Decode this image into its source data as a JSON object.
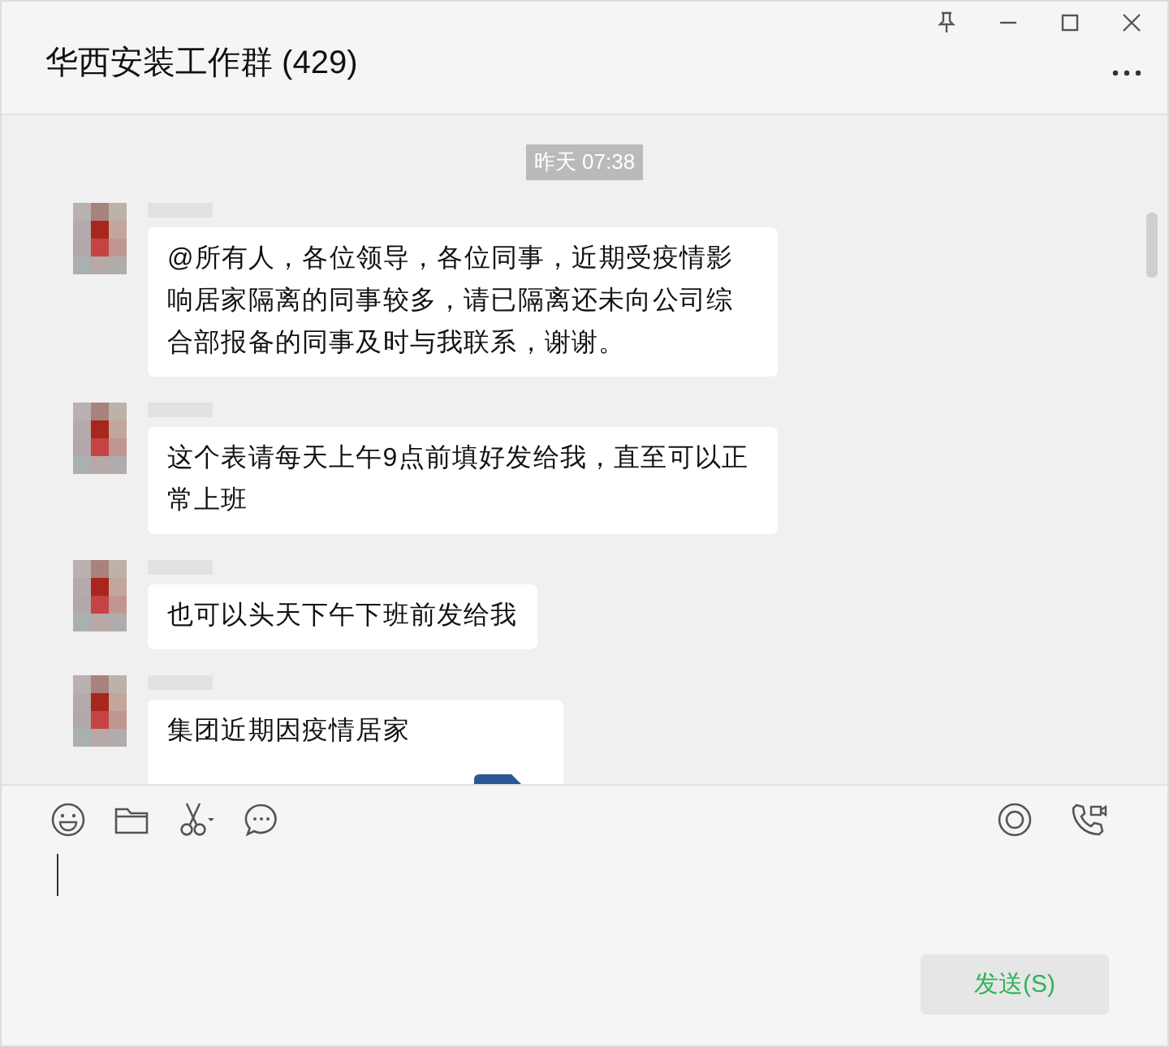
{
  "window": {
    "title": "华西安装工作群 (429)"
  },
  "timestamp": "昨天 07:38",
  "messages": [
    {
      "kind": "text",
      "text": "@所有人，各位领导，各位同事，近期受疫情影响居家隔离的同事较多，请已隔离还未向公司综合部报备的同事及时与我联系，谢谢。"
    },
    {
      "kind": "text",
      "text": "这个表请每天上午9点前填好发给我，直至可以正常上班"
    },
    {
      "kind": "text",
      "text": "也可以头天下午下班前发给我"
    },
    {
      "kind": "file",
      "text": "集团近期因疫情居家"
    }
  ],
  "composer": {
    "send_button": "发送(S)"
  }
}
